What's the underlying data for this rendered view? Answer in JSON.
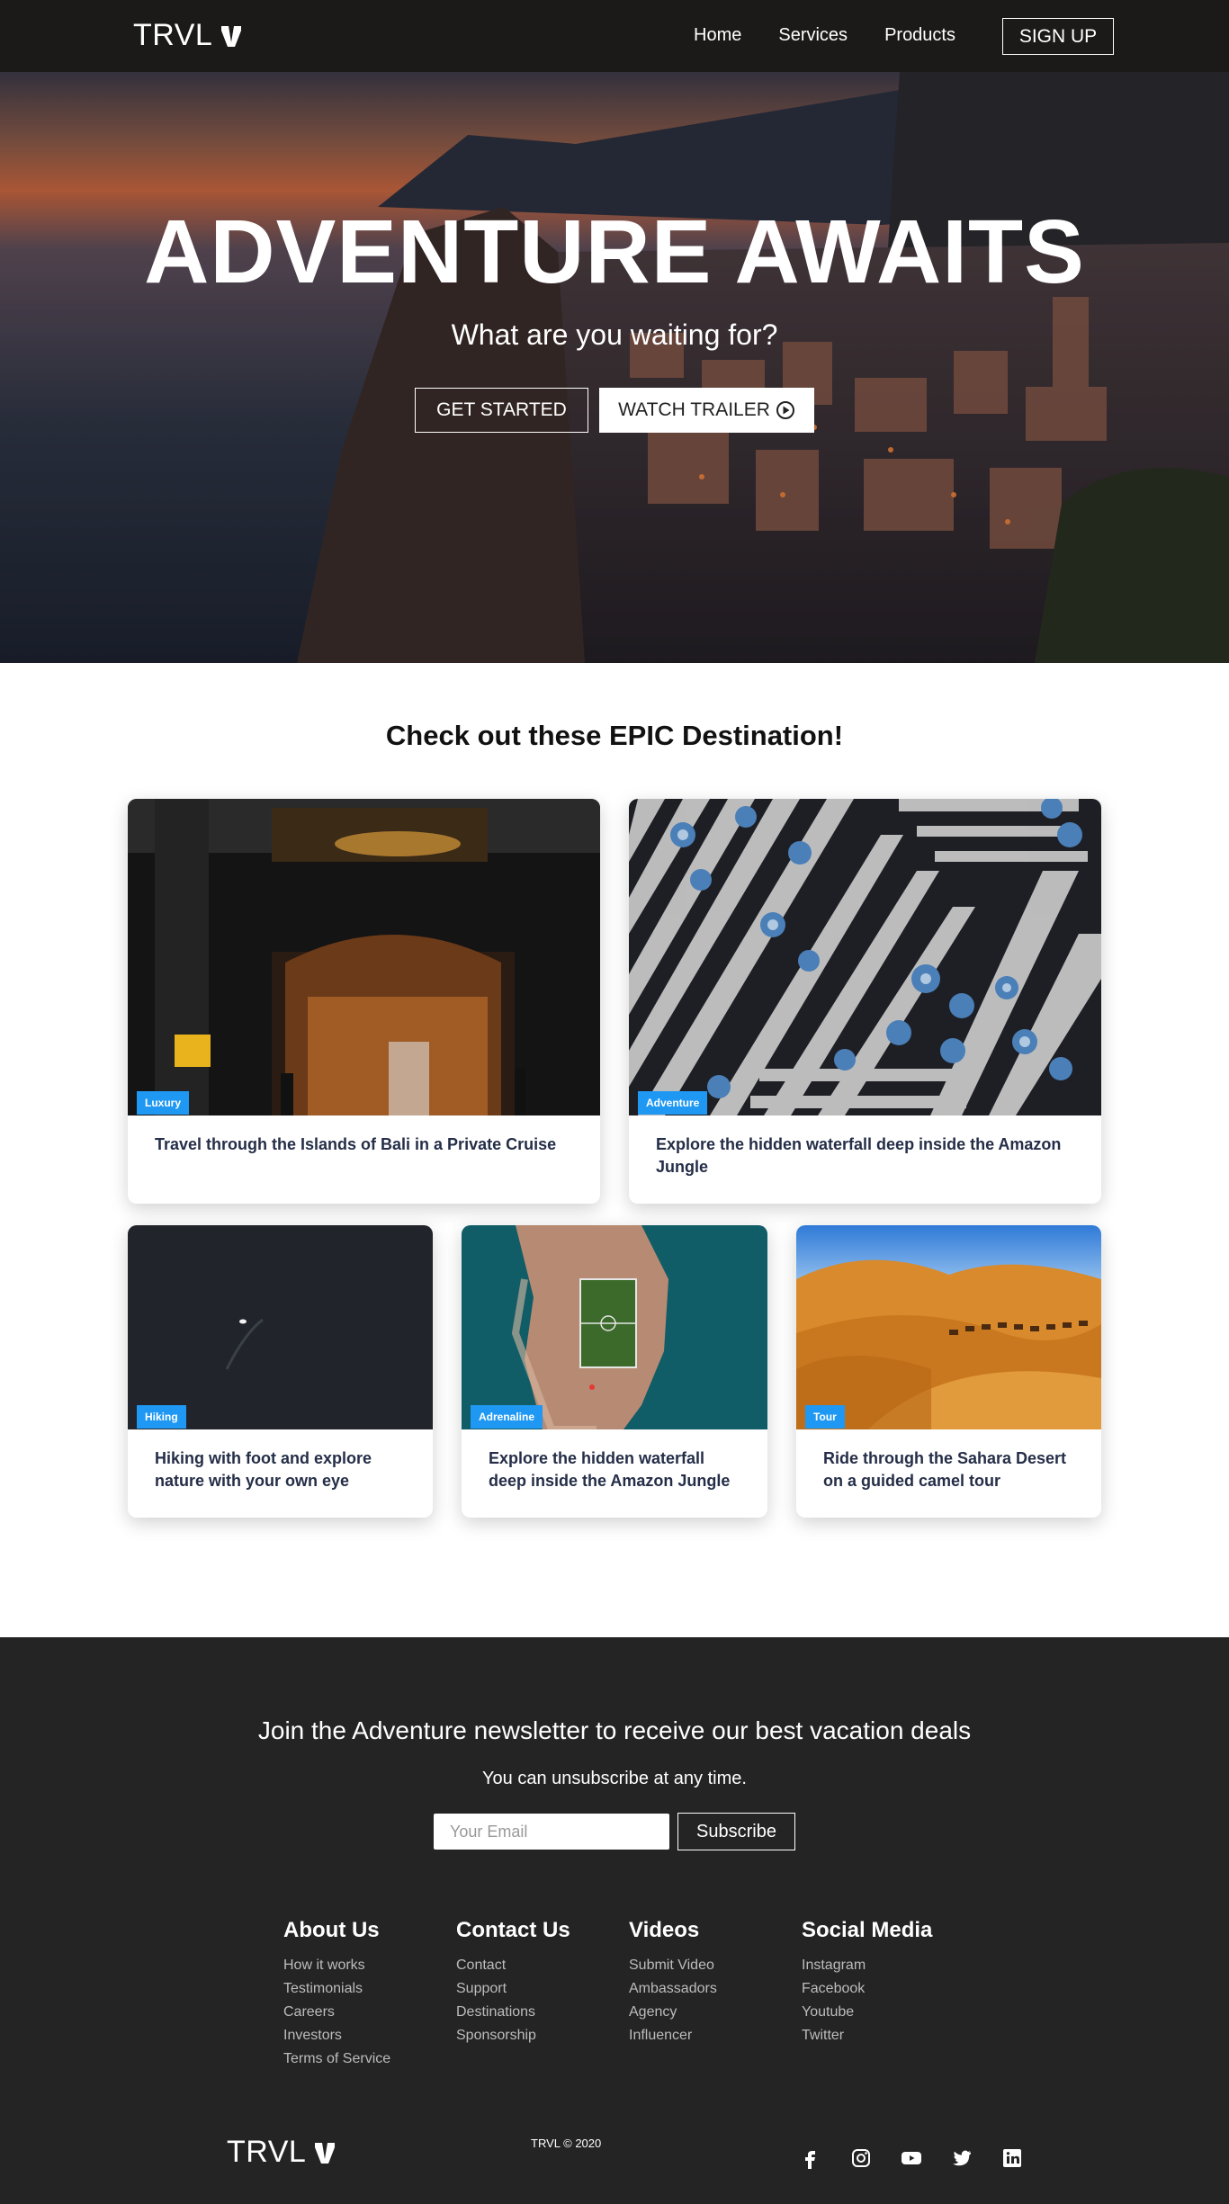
{
  "nav": {
    "logo": "TRVL",
    "links": [
      "Home",
      "Services",
      "Products"
    ],
    "signup": "SIGN UP"
  },
  "hero": {
    "title": "ADVENTURE AWAITS",
    "subtitle": "What are you waiting for?",
    "start_label": "GET STARTED",
    "trailer_label": "WATCH TRAILER"
  },
  "destinations": {
    "title": "Check out these EPIC Destination!",
    "cards": [
      {
        "tag": "Luxury",
        "text": "Travel through the Islands of Bali in a Private Cruise"
      },
      {
        "tag": "Adventure",
        "text": "Explore the hidden waterfall deep inside the Amazon Jungle"
      },
      {
        "tag": "Hiking",
        "text": "Hiking with foot and explore nature with your own eye"
      },
      {
        "tag": "Adrenaline",
        "text": "Explore the hidden waterfall deep inside the Amazon Jungle"
      },
      {
        "tag": "Tour",
        "text": "Ride through the Sahara Desert on a guided camel tour"
      }
    ]
  },
  "newsletter": {
    "title": "Join the Adventure newsletter to receive our best vacation deals",
    "subtitle": "You can unsubscribe at any time.",
    "placeholder": "Your Email",
    "button": "Subscribe"
  },
  "footer_links": [
    {
      "heading": "About Us",
      "items": [
        "How it works",
        "Testimonials",
        "Careers",
        "Investors",
        "Terms of Service"
      ]
    },
    {
      "heading": "Contact Us",
      "items": [
        "Contact",
        "Support",
        "Destinations",
        "Sponsorship"
      ]
    },
    {
      "heading": "Videos",
      "items": [
        "Submit Video",
        "Ambassadors",
        "Agency",
        "Influencer"
      ]
    },
    {
      "heading": "Social Media",
      "items": [
        "Instagram",
        "Facebook",
        "Youtube",
        "Twitter"
      ]
    }
  ],
  "footer": {
    "logo": "TRVL",
    "copyright": "TRVL © 2020",
    "social_icons": [
      "facebook-icon",
      "instagram-icon",
      "youtube-icon",
      "twitter-icon",
      "linkedin-icon"
    ]
  },
  "colors": {
    "nav_bg": "#1b1a19",
    "footer_bg": "#242424",
    "tag_blue": "#1f98f4",
    "card_text": "#252e48"
  }
}
